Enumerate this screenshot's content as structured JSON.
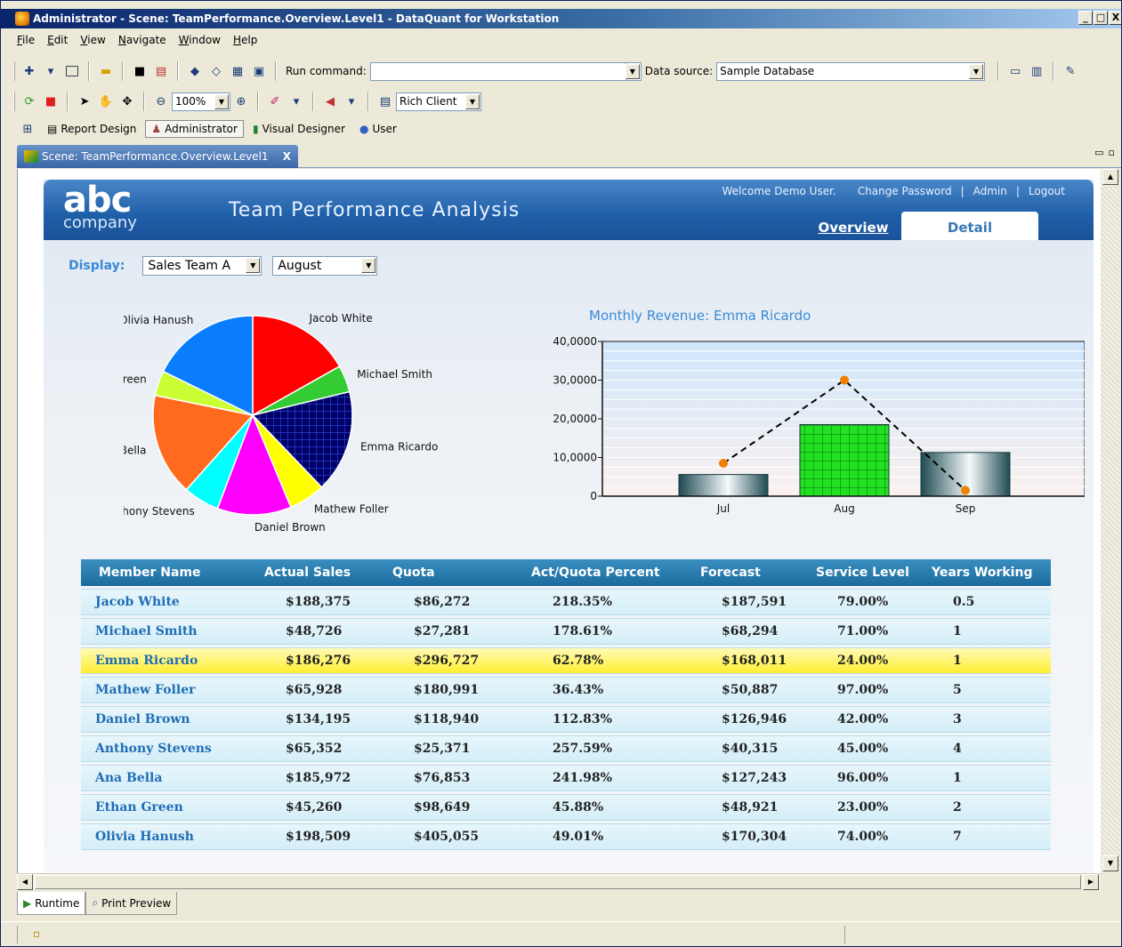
{
  "window": {
    "title": "Administrator - Scene: TeamPerformance.Overview.Level1 - DataQuant for Workstation",
    "controls": [
      "_",
      "□",
      "X"
    ]
  },
  "menu": [
    "File",
    "Edit",
    "View",
    "Navigate",
    "Window",
    "Help"
  ],
  "toolbar": {
    "run_command_label": "Run command:",
    "run_command_value": "",
    "data_source_label": "Data source:",
    "data_source_value": "Sample Database",
    "zoom_value": "100%",
    "client_value": "Rich Client"
  },
  "perspectives": [
    {
      "label": "Report Design",
      "icon": "report-design-icon"
    },
    {
      "label": "Administrator",
      "icon": "administrator-icon",
      "active": true
    },
    {
      "label": "Visual Designer",
      "icon": "visual-designer-icon"
    },
    {
      "label": "User",
      "icon": "user-icon"
    }
  ],
  "doc_tab": {
    "label": "Scene: TeamPerformance.Overview.Level1",
    "close": "X"
  },
  "dashboard": {
    "logo_top": "abc",
    "logo_bottom": "company",
    "title": "Team Performance Analysis",
    "welcome": "Welcome Demo User.",
    "links": [
      "Change Password",
      "|",
      "Admin",
      "|",
      "Logout"
    ],
    "tabs": [
      {
        "label": "Overview",
        "active": false
      },
      {
        "label": "Detail",
        "active": true
      }
    ],
    "display_label": "Display:",
    "team_value": "Sales Team A",
    "month_value": "August"
  },
  "chart_data": [
    {
      "type": "pie",
      "slices": [
        {
          "label": "Jacob White",
          "value": 188375,
          "color": "#ff0000"
        },
        {
          "label": "Michael Smith",
          "value": 48726,
          "color": "#33cc33"
        },
        {
          "label": "Emma Ricardo",
          "value": 186276,
          "color": "#000066",
          "pattern": "grid"
        },
        {
          "label": "Mathew Foller",
          "value": 65928,
          "color": "#ffff00"
        },
        {
          "label": "Daniel Brown",
          "value": 134195,
          "color": "#ff00ff"
        },
        {
          "label": "Anthony Stevens",
          "value": 65352,
          "color": "#00ffff"
        },
        {
          "label": "Ana Bella",
          "value": 185972,
          "color": "#ff6a1f"
        },
        {
          "label": "Ethan Green",
          "value": 45260,
          "color": "#ccff33"
        },
        {
          "label": "Olivia Hanush",
          "value": 198509,
          "color": "#0a7dff"
        }
      ]
    },
    {
      "type": "bar",
      "title": "Monthly Revenue: Emma Ricardo",
      "categories": [
        "Jul",
        "Aug",
        "Sep"
      ],
      "series": [
        {
          "kind": "bar",
          "values": [
            5600,
            18500,
            11300
          ]
        },
        {
          "kind": "line",
          "values": [
            8500,
            30000,
            1500
          ],
          "color": "#f08000"
        }
      ],
      "ylim": [
        0,
        40000
      ],
      "yticks": [
        "0",
        "10,0000",
        "20,0000",
        "30,0000",
        "40,0000"
      ],
      "grid": true
    }
  ],
  "table": {
    "headers": [
      "Member Name",
      "Actual Sales",
      "Quota",
      "Act/Quota Percent",
      "Forecast",
      "Service Level",
      "Years Working"
    ],
    "rows": [
      [
        "Jacob White",
        "$188,375",
        "$86,272",
        "218.35%",
        "$187,591",
        "79.00%",
        "0.5"
      ],
      [
        "Michael Smith",
        "$48,726",
        "$27,281",
        "178.61%",
        "$68,294",
        "71.00%",
        "1"
      ],
      [
        "Emma Ricardo",
        "$186,276",
        "$296,727",
        "62.78%",
        "$168,011",
        "24.00%",
        "1"
      ],
      [
        "Mathew Foller",
        "$65,928",
        "$180,991",
        "36.43%",
        "$50,887",
        "97.00%",
        "5"
      ],
      [
        "Daniel Brown",
        "$134,195",
        "$118,940",
        "112.83%",
        "$126,946",
        "42.00%",
        "3"
      ],
      [
        "Anthony Stevens",
        "$65,352",
        "$25,371",
        "257.59%",
        "$40,315",
        "45.00%",
        "4"
      ],
      [
        "Ana Bella",
        "$185,972",
        "$76,853",
        "241.98%",
        "$127,243",
        "96.00%",
        "1"
      ],
      [
        "Ethan Green",
        "$45,260",
        "$98,649",
        "45.88%",
        "$48,921",
        "23.00%",
        "2"
      ],
      [
        "Olivia Hanush",
        "$198,509",
        "$405,055",
        "49.01%",
        "$170,304",
        "74.00%",
        "7"
      ]
    ],
    "highlighted_row": 2
  },
  "bottom_tabs": [
    {
      "label": "Runtime",
      "active": true
    },
    {
      "label": "Print Preview",
      "active": false
    }
  ]
}
